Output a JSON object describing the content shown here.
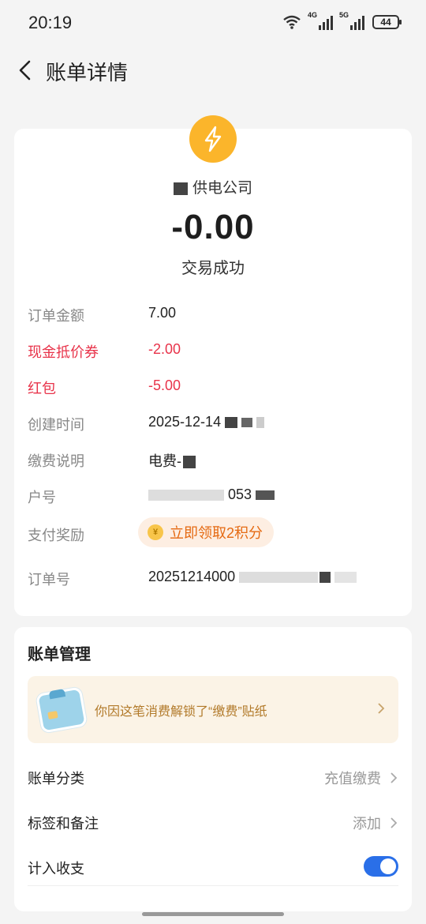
{
  "status_bar": {
    "time": "20:19",
    "net1": "4G",
    "net2": "5G",
    "battery": "44"
  },
  "header": {
    "title": "账单详情",
    "back_icon": "chevron-left-icon"
  },
  "transaction": {
    "icon": "lightning-icon",
    "icon_color": "#fbb52b",
    "merchant": "供电公司",
    "amount": "-0.00",
    "status": "交易成功"
  },
  "details": [
    {
      "label": "订单金额",
      "value": "7.00",
      "emphasis": false
    },
    {
      "label": "现金抵价券",
      "value": "-2.00",
      "emphasis": true
    },
    {
      "label": "红包",
      "value": "-5.00",
      "emphasis": true
    },
    {
      "label": "创建时间",
      "value": "2025-12-14",
      "emphasis": false
    },
    {
      "label": "缴费说明",
      "value": "电费-",
      "emphasis": false
    },
    {
      "label": "户号",
      "value": "053",
      "emphasis": false
    },
    {
      "label": "支付奖励",
      "value": "立即领取2积分",
      "emphasis": false
    },
    {
      "label": "订单号",
      "value": "20251214000",
      "emphasis": false
    }
  ],
  "management": {
    "title": "账单管理",
    "sticker_text": "你因这笔消费解锁了“缴费”贴纸",
    "category_label": "账单分类",
    "category_value": "充值缴费",
    "tags_label": "标签和备注",
    "tags_value": "添加",
    "include_label": "计入收支",
    "include_on": true
  },
  "colors": {
    "accent": "#2a6fe8",
    "negative": "#e8334a",
    "reward": "#e56a12"
  }
}
